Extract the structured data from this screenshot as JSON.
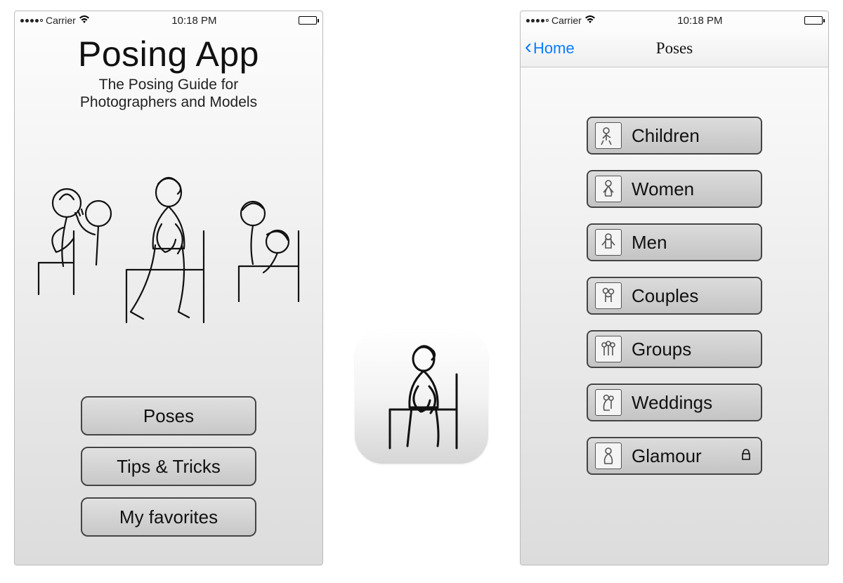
{
  "status_bar": {
    "carrier": "Carrier",
    "time": "10:18 PM"
  },
  "home": {
    "title": "Posing App",
    "subtitle_line1": "The Posing Guide for",
    "subtitle_line2": "Photographers and Models",
    "buttons": [
      {
        "label": "Poses"
      },
      {
        "label": "Tips & Tricks"
      },
      {
        "label": "My favorites"
      }
    ]
  },
  "poses_screen": {
    "back_label": "Home",
    "nav_title": "Poses",
    "categories": [
      {
        "label": "Children",
        "locked": false
      },
      {
        "label": "Women",
        "locked": false
      },
      {
        "label": "Men",
        "locked": false
      },
      {
        "label": "Couples",
        "locked": false
      },
      {
        "label": "Groups",
        "locked": false
      },
      {
        "label": "Weddings",
        "locked": false
      },
      {
        "label": "Glamour",
        "locked": true
      }
    ]
  }
}
